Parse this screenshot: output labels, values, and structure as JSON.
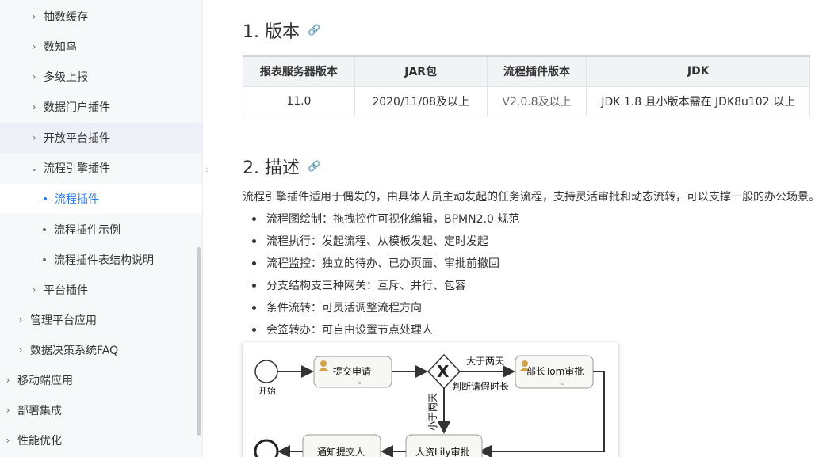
{
  "sidebar": {
    "items": [
      {
        "label": "抽数缓存"
      },
      {
        "label": "数知鸟"
      },
      {
        "label": "多级上报"
      },
      {
        "label": "数据门户插件"
      },
      {
        "label": "开放平台插件"
      },
      {
        "label": "流程引擎插件"
      },
      {
        "label": "流程插件"
      },
      {
        "label": "流程插件示例"
      },
      {
        "label": "流程插件表结构说明"
      },
      {
        "label": "平台插件"
      },
      {
        "label": "管理平台应用"
      },
      {
        "label": "数据决策系统FAQ"
      },
      {
        "label": "移动端应用"
      },
      {
        "label": "部署集成"
      },
      {
        "label": "性能优化"
      }
    ]
  },
  "section1": {
    "title": "1. 版本",
    "table": {
      "headers": [
        "报表服务器版本",
        "JAR包",
        "流程插件版本",
        "JDK"
      ],
      "rows": [
        [
          "11.0",
          "2020/11/08及以上",
          "V2.0.8及以上",
          "JDK 1.8 且小版本需在 JDK8u102 以上"
        ]
      ]
    }
  },
  "section2": {
    "title": "2. 描述",
    "description": "流程引擎插件适用于偶发的，由具体人员主动发起的任务流程，支持灵活审批和动态流转，可以支撑一般的办公场景。",
    "features": [
      "流程图绘制：拖拽控件可视化编辑，BPMN2.0 规范",
      "流程执行：发起流程、从模板发起、定时发起",
      "流程监控：独立的待办、已办页面、审批前撤回",
      "分支结构支三种网关：互斥、并行、包容",
      "条件流转：可灵活调整流程方向",
      "会签转办：可自由设置节点处理人"
    ]
  },
  "diagram": {
    "start_label": "开始",
    "submit": "提交申请",
    "gateway_label": "判断请假时长",
    "more_than": "大于两天",
    "less_than": "小于两天",
    "manager": "部长Tom审批",
    "hr": "人资Lily审批",
    "notify": "通知提交人"
  },
  "colors": {
    "accent": "#2f7ce8"
  }
}
